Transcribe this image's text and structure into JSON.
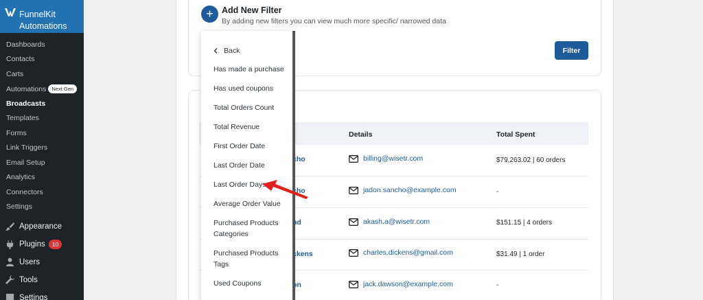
{
  "sidebar": {
    "brand_line1": "FunnelKit",
    "brand_line2": "Automations",
    "sub_items": [
      "Dashboards",
      "Contacts",
      "Carts",
      "Automations",
      "Broadcasts",
      "Templates",
      "Forms",
      "Link Triggers",
      "Email Setup",
      "Analytics",
      "Connectors",
      "Settings"
    ],
    "automations_badge": "Next Gen",
    "menu": [
      {
        "label": "Appearance",
        "icon": "paintbrush-icon"
      },
      {
        "label": "Plugins",
        "icon": "plugin-icon",
        "badge": "10"
      },
      {
        "label": "Users",
        "icon": "user-icon"
      },
      {
        "label": "Tools",
        "icon": "wrench-icon"
      },
      {
        "label": "Settings",
        "icon": "settings-icon"
      }
    ]
  },
  "filter_card": {
    "title": "Add New Filter",
    "description": "By adding new filters you can view much more specific/ narrowed data",
    "filter_button": "Filter"
  },
  "table": {
    "headers": {
      "details": "Details",
      "total_spent": "Total Spent"
    },
    "rows": [
      {
        "name": "cho",
        "email": "billing@wisetr.com",
        "spent": "$79,263.02 | 60 orders"
      },
      {
        "name": "cho",
        "email": "jadon.sancho@example.com",
        "spent": "-"
      },
      {
        "name": "nd",
        "email": "akash.a@wisetr.com",
        "spent": "$151.15 | 4 orders"
      },
      {
        "name": "ckens",
        "email": "charles.dickens@gmail.com",
        "spent": "$31.49 | 1 order"
      },
      {
        "name": "on",
        "email": "jack.dawson@example.com",
        "spent": "-"
      }
    ]
  },
  "dropdown": {
    "back": "Back",
    "items": [
      "Has made a purchase",
      "Has used coupons",
      "Total Orders Count",
      "Total Revenue",
      "First Order Date",
      "Last Order Date",
      "Last Order Days",
      "Average Order Value",
      "Purchased Products Categories",
      "Purchased Products Tags",
      "Used Coupons"
    ]
  },
  "colors": {
    "accent": "#1e5b9a",
    "sidebar": "#1d2327",
    "brand": "#2271b1",
    "arrow": "#e0211b"
  }
}
